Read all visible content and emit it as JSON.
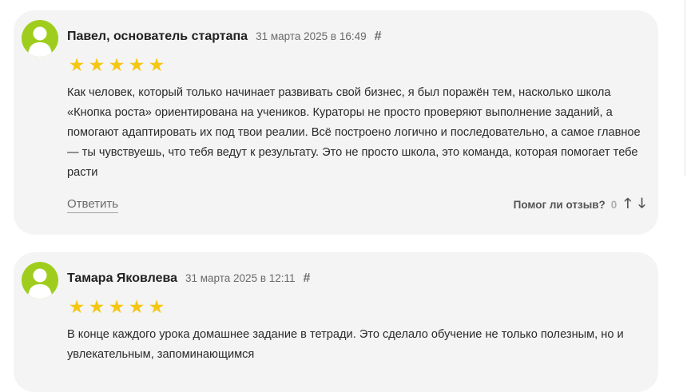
{
  "colors": {
    "card_background": "#f4f4f4",
    "avatar": "#9fcd1e",
    "star": "#f6c711"
  },
  "reviews": [
    {
      "author": "Павел, основатель стартапа",
      "date": "31 марта 2025 в 16:49",
      "permalink": "#",
      "rating": 5,
      "stars": [
        "★",
        "★",
        "★",
        "★",
        "★"
      ],
      "text": "Как человек, который только начинает развивать свой бизнес, я был поражён тем, насколько школа «Кнопка роста» ориентирована на учеников. Кураторы не просто проверяют выполнение заданий, а помогают адаптировать их под твои реалии. Всё построено логично и последовательно, а самое главное — ты чувствуешь, что тебя ведут к результату. Это не просто школа, это команда, которая помогает тебе расти",
      "reply_label": "Ответить",
      "helpful_label": "Помог ли отзыв?",
      "helpful_count": "0",
      "vote_up": "🡑",
      "vote_down": "🡓"
    },
    {
      "author": "Тамара Яковлева",
      "date": "31 марта 2025 в 12:11",
      "permalink": "#",
      "rating": 5,
      "stars": [
        "★",
        "★",
        "★",
        "★",
        "★"
      ],
      "text": "В конце каждого урока домашнее задание в тетради. Это сделало обучение не только полезным, но и увлекательным, запоминающимся"
    }
  ]
}
